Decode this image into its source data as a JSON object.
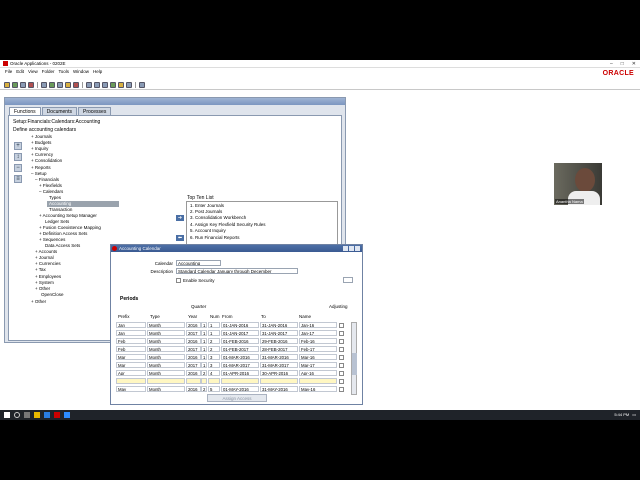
{
  "window": {
    "title": "Oracle Applications - 0202E"
  },
  "menu": [
    "File",
    "Edit",
    "View",
    "Folder",
    "Tools",
    "Window",
    "Help"
  ],
  "logo": "ORACLE",
  "navigator": {
    "tabs": [
      "Functions",
      "Documents",
      "Processes"
    ],
    "heading": "Setup:Financials:Calendars:Accounting",
    "subheading": "Define accounting calendars",
    "tree": [
      "+  Journals",
      "+  Budgets",
      "+  Inquiry",
      "+  Currency",
      "+  Consolidation",
      "+  Reports",
      "–  Setup",
      "–  Financials",
      "+  Flexfields",
      "–  Calendars",
      "Types",
      "Accounting",
      "Transaction",
      "+  Accounting Setup Manager",
      "Ledger Sets",
      "+  Fusion Coexistence Mapping",
      "+  Definition Access Sets",
      "+  Sequences",
      "Data Access Sets",
      "+  Accounts",
      "+  Journal",
      "+  Currencies",
      "+  Tax",
      "+  Employees",
      "+  System",
      "+  Other",
      "OpenClose",
      "+  Other"
    ],
    "top_ten_label": "Top Ten List",
    "top_ten": [
      "1. Enter Journals",
      "2. Post Journals",
      "3. Consolidation Workbench",
      "4. Assign Key Flexfield Security Rules",
      "5. Account Inquiry",
      "6. Run Financial Reports"
    ]
  },
  "calendar": {
    "title": "Accounting Calendar",
    "calendar_label": "Calendar",
    "calendar_value": "Accounting",
    "description_label": "Description",
    "description_value": "Standard Calendar January through December",
    "enable_security": "Enable Security",
    "periods_label": "Periods",
    "headers": {
      "quarter": "Quarter",
      "adjusting": "Adjusting",
      "prefix": "Prefix",
      "type": "Type",
      "year": "Year",
      "num": "Num",
      "from": "From",
      "to": "To",
      "name": "Name"
    },
    "rows": [
      {
        "prefix": "Jan",
        "type": "Month",
        "year": "2016",
        "q": "1",
        "num": "1",
        "from": "01-JAN-2016",
        "to": "31-JAN-2016",
        "name": "Jan-16"
      },
      {
        "prefix": "Jan",
        "type": "Month",
        "year": "2017",
        "q": "1",
        "num": "1",
        "from": "01-JAN-2017",
        "to": "31-JAN-2017",
        "name": "Jan-17"
      },
      {
        "prefix": "Feb",
        "type": "Month",
        "year": "2016",
        "q": "1",
        "num": "2",
        "from": "01-FEB-2016",
        "to": "29-FEB-2016",
        "name": "Feb-16"
      },
      {
        "prefix": "Feb",
        "type": "Month",
        "year": "2017",
        "q": "1",
        "num": "2",
        "from": "01-FEB-2017",
        "to": "28-FEB-2017",
        "name": "Feb-17"
      },
      {
        "prefix": "Mar",
        "type": "Month",
        "year": "2016",
        "q": "1",
        "num": "3",
        "from": "01-MAR-2016",
        "to": "31-MAR-2016",
        "name": "Mar-16"
      },
      {
        "prefix": "Mar",
        "type": "Month",
        "year": "2017",
        "q": "1",
        "num": "3",
        "from": "01-MAR-2017",
        "to": "31-MAR-2017",
        "name": "Mar-17"
      },
      {
        "prefix": "Apr",
        "type": "Month",
        "year": "2016",
        "q": "2",
        "num": "4",
        "from": "01-APR-2016",
        "to": "30-APR-2016",
        "name": "Apr-16"
      },
      {
        "prefix": "",
        "type": "",
        "year": "",
        "q": "",
        "num": "",
        "from": "",
        "to": "",
        "name": ""
      },
      {
        "prefix": "May",
        "type": "Month",
        "year": "2016",
        "q": "2",
        "num": "5",
        "from": "01-MAY-2016",
        "to": "31-MAY-2016",
        "name": "May-16"
      }
    ],
    "assign_button": "Assign Access"
  },
  "video": {
    "name": "Anantha Nama"
  },
  "taskbar": {
    "time": "5:44 PM"
  }
}
